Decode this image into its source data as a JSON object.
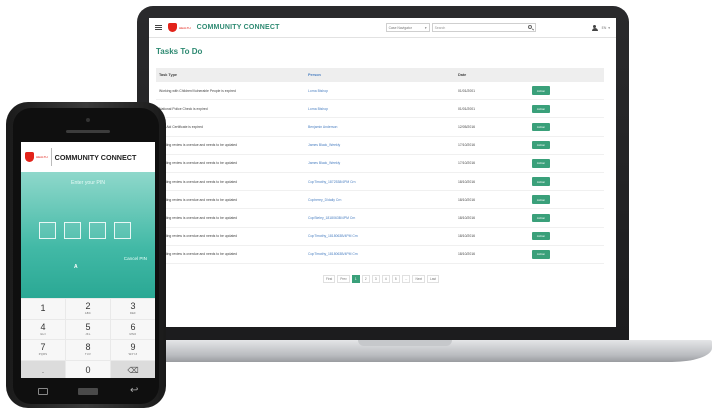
{
  "laptop_app": {
    "title": "COMMUNITY CONNECT",
    "logo_tag": "HEALTH",
    "select_label": "Case Navigator",
    "search_placeholder": "Search",
    "lang": "EN",
    "page_title": "Tasks To Do",
    "table": {
      "headers": [
        "Task Type",
        "Person",
        "Date",
        ""
      ],
      "rows": [
        {
          "task": "Working with Children/Vulnerable People is expired",
          "person": "Lorna Bishop",
          "date": "01/01/2001"
        },
        {
          "task": "National Police Check is expired",
          "person": "Lorna Bishop",
          "date": "01/01/2001"
        },
        {
          "task": "First Aid Certificate is expired",
          "person": "Benjamin Anderson",
          "date": "12/05/2016"
        },
        {
          "task": "Funding review is overdue and needs to be updated",
          "person": "James Black_Weekly",
          "date": "17/10/2016"
        },
        {
          "task": "Funding review is overdue and needs to be updated",
          "person": "James Black_Weekly",
          "date": "17/10/2016"
        },
        {
          "task": "Funding review is overdue and needs to be updated",
          "person": "CopTimothy_1872538/4PM Crn",
          "date": "18/10/2016"
        },
        {
          "task": "Funding review is overdue and needs to be updated",
          "person": "Copherey_D/daily Crn",
          "date": "18/10/2016"
        },
        {
          "task": "Funding review is overdue and needs to be updated",
          "person": "CopSteley_1818063B/4PM Crn",
          "date": "18/10/2016"
        },
        {
          "task": "Funding review is overdue and needs to be updated",
          "person": "CopTimothy_1818063B/4PM Crn",
          "date": "18/10/2016"
        },
        {
          "task": "Funding review is overdue and needs to be updated",
          "person": "CopTimothy_1818063B/4PM Crn",
          "date": "18/10/2016"
        }
      ],
      "action_label": "Action"
    },
    "pagination": [
      "First",
      "Prev",
      "1",
      "2",
      "3",
      "4",
      "5",
      "...",
      "Next",
      "Last"
    ]
  },
  "phone_app": {
    "logo_tag": "HEALTH",
    "title": "COMMUNITY CONNECT",
    "pin_prompt": "Enter your PIN",
    "pin_cursor": "A",
    "cancel_label": "Cancel PIN",
    "keys": [
      {
        "num": "1",
        "sub": ""
      },
      {
        "num": "2",
        "sub": "ABC"
      },
      {
        "num": "3",
        "sub": "DEF"
      },
      {
        "num": "4",
        "sub": "GHI"
      },
      {
        "num": "5",
        "sub": "JKL"
      },
      {
        "num": "6",
        "sub": "MNO"
      },
      {
        "num": "7",
        "sub": "PQRS"
      },
      {
        "num": "8",
        "sub": "TUV"
      },
      {
        "num": "9",
        "sub": "WXYZ"
      },
      {
        "num": ".",
        "sub": ""
      },
      {
        "num": "0",
        "sub": ""
      },
      {
        "num": "⌫",
        "sub": ""
      }
    ]
  },
  "colors": {
    "brand_green": "#2e8a72",
    "action_green": "#3aa07a",
    "link_blue": "#4a7fc1",
    "logo_red": "#e2231a",
    "pin_teal": "#42b9a6"
  }
}
